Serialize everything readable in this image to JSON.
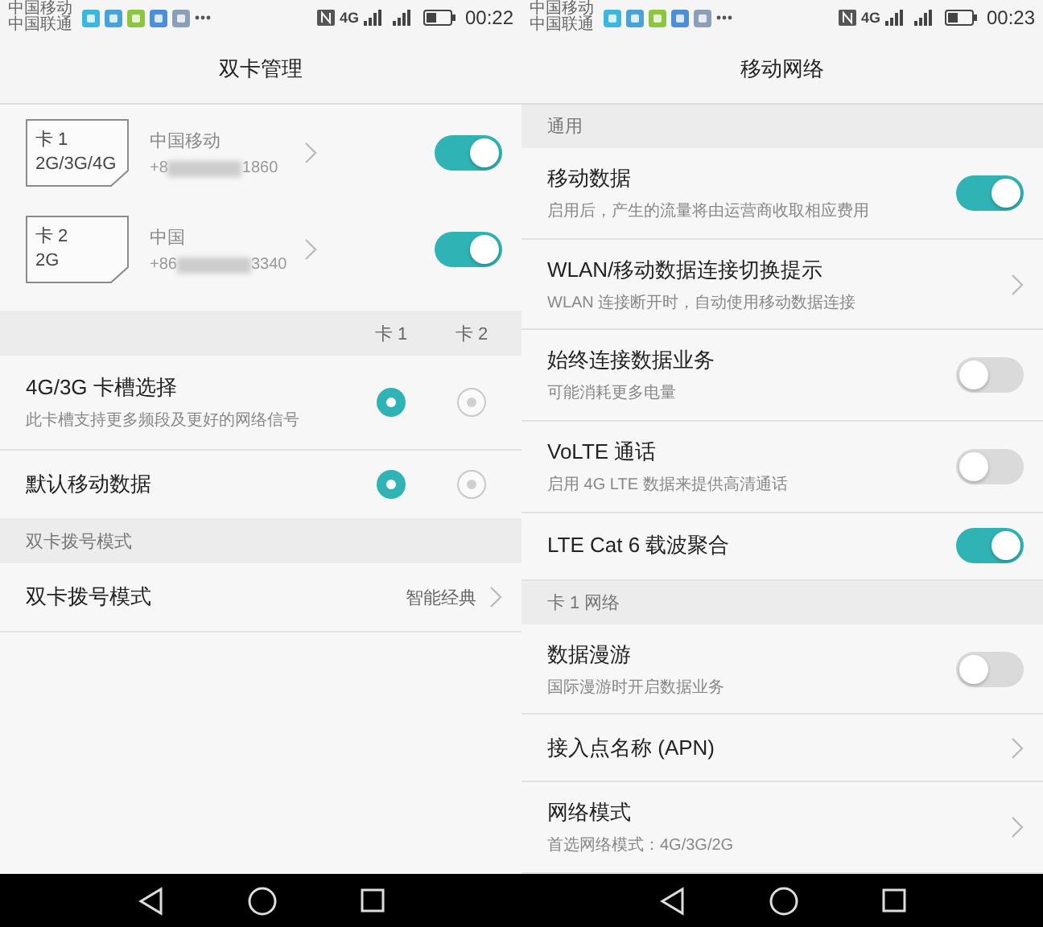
{
  "screens": [
    {
      "status_bar": {
        "carriers": [
          "中国移动",
          "中国联通"
        ],
        "network": "4G",
        "time": "00:22"
      },
      "title": "双卡管理",
      "sim_cards": [
        {
          "label": "卡 1",
          "types": "2G/3G/4G",
          "carrier": "中国移动",
          "number_start": "+8",
          "number_end": "1860",
          "on": true
        },
        {
          "label": "卡 2",
          "types": "2G",
          "carrier": "中国",
          "number_start": "+86",
          "number_end": "3340",
          "on": true
        }
      ],
      "slot_columns": [
        "卡 1",
        "卡 2"
      ],
      "slot_rows": [
        {
          "title": "4G/3G 卡槽选择",
          "subtitle": "此卡槽支持更多频段及更好的网络信号",
          "options": [
            {
              "selected": true
            },
            {
              "selected": false
            }
          ]
        },
        {
          "title": "默认移动数据",
          "options": [
            {
              "selected": true
            },
            {
              "selected": false
            }
          ]
        }
      ],
      "items": [
        {
          "kind": "header",
          "title": "双卡拨号模式"
        },
        {
          "kind": "link",
          "title": "双卡拨号模式",
          "value": "智能经典"
        }
      ]
    },
    {
      "status_bar": {
        "carriers": [
          "中国移动",
          "中国联通"
        ],
        "network": "4G",
        "time": "00:23"
      },
      "title": "移动网络",
      "items": [
        {
          "kind": "header",
          "title": "通用"
        },
        {
          "kind": "toggle",
          "title": "移动数据",
          "subtitle": "启用后，产生的流量将由运营商收取相应费用",
          "on": true
        },
        {
          "kind": "link",
          "title": "WLAN/移动数据连接切换提示",
          "subtitle": "WLAN 连接断开时，自动使用移动数据连接"
        },
        {
          "kind": "toggle",
          "title": "始终连接数据业务",
          "subtitle": "可能消耗更多电量",
          "on": false
        },
        {
          "kind": "toggle",
          "title": "VoLTE 通话",
          "subtitle": "启用 4G LTE 数据来提供高清通话",
          "on": false
        },
        {
          "kind": "toggle",
          "title": "LTE Cat 6 载波聚合",
          "on": true
        },
        {
          "kind": "header",
          "title": "卡 1 网络"
        },
        {
          "kind": "toggle",
          "title": "数据漫游",
          "subtitle": "国际漫游时开启数据业务",
          "on": false
        },
        {
          "kind": "link",
          "title": "接入点名称 (APN)"
        },
        {
          "kind": "link",
          "title": "网络模式",
          "subtitle": "首选网络模式：4G/3G/2G"
        }
      ]
    }
  ]
}
